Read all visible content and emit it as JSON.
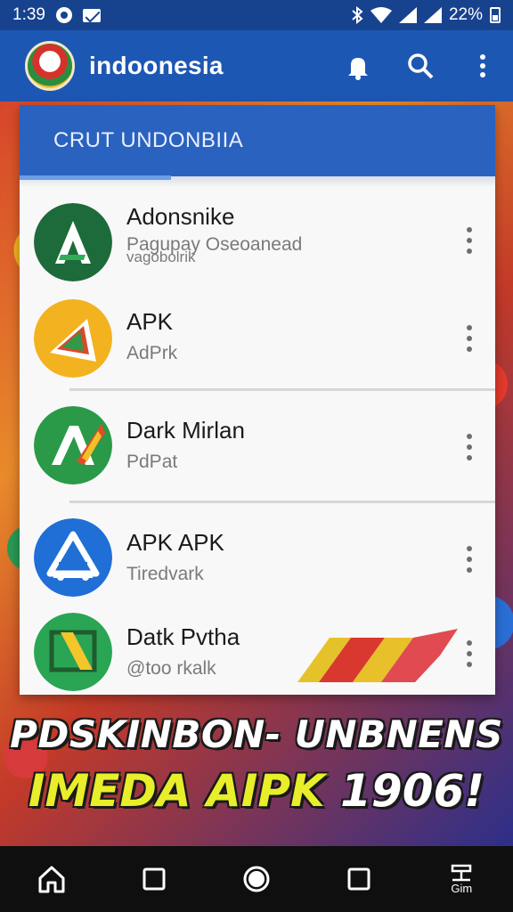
{
  "status_bar": {
    "time": "1:39",
    "battery": "22%"
  },
  "app_bar": {
    "title": "indoonesia",
    "icons": [
      "bell-icon",
      "search-icon",
      "more-vert-icon"
    ]
  },
  "card": {
    "tab_label": "CRUT UNDONBIIA",
    "items": [
      {
        "title": "Adonsnike",
        "subtitle": "Pagupay Oseoanead",
        "subtitle2": "vagobolrik",
        "icon": "green-a-icon"
      },
      {
        "title": "APK",
        "subtitle": "AdPrk",
        "icon": "yellow-a-icon"
      },
      {
        "title": "Dark Mirlan",
        "subtitle": "PdPat",
        "icon": "green-arrow-a-icon"
      },
      {
        "title": "APK APK",
        "subtitle": "Tiredvark",
        "icon": "blue-a-icon"
      },
      {
        "title": "Datk Pvtha",
        "subtitle": "@too rkalk",
        "icon": "green-square-icon"
      }
    ]
  },
  "banner": {
    "line1": "PDSKINBON- UNBNENS",
    "line2_text": "IMEDA AIPK ",
    "line2_num": "1906!"
  },
  "nav_bar": {
    "extra_label": "Gim"
  },
  "colors": {
    "app_bar": "#1d57b4",
    "status_bar": "#17428e",
    "card_header": "#2a62bf",
    "banner_yellow": "#e8ee2a"
  }
}
